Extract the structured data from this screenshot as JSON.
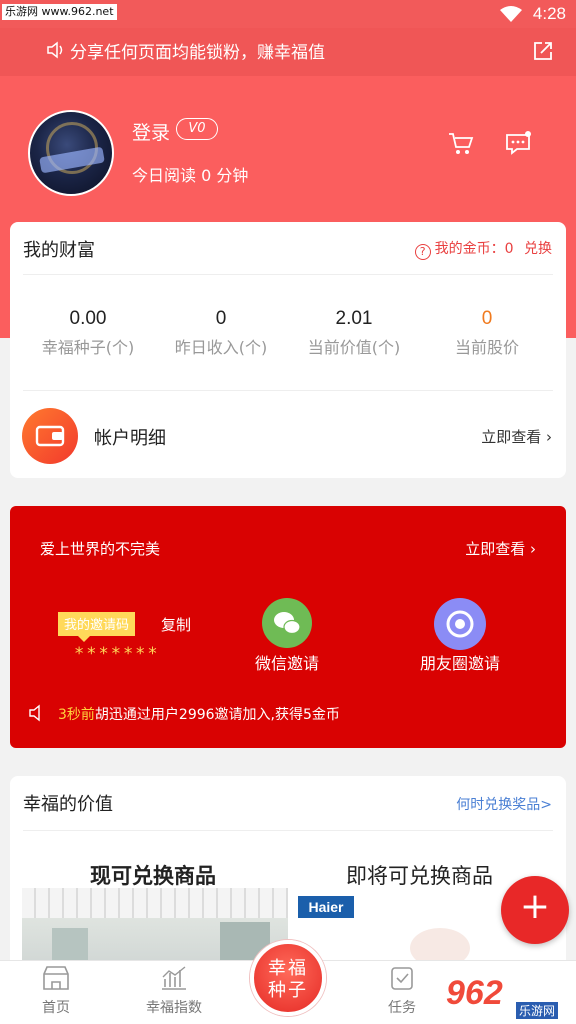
{
  "status_bar": {
    "watermark": "乐游网 www.962.net",
    "time": "4:28"
  },
  "share_bar": {
    "text": "分享任何页面均能锁粉，赚幸福值"
  },
  "profile": {
    "login": "登录",
    "level": "V0",
    "reading": "今日阅读 0 分钟"
  },
  "wealth": {
    "title": "我的财富",
    "coins_label": "我的金币：0",
    "exchange": "兑换",
    "stats": [
      {
        "value": "0.00",
        "label": "幸福种子(个)"
      },
      {
        "value": "0",
        "label": "昨日收入(个)"
      },
      {
        "value": "2.01",
        "label": "当前价值(个)"
      },
      {
        "value": "0",
        "label": "当前股价"
      }
    ],
    "account_label": "帐户明细",
    "view_now": "立即查看"
  },
  "invite": {
    "title": "爱上世界的不完美",
    "view_now": "立即查看",
    "code_tag": "我的邀请码",
    "copy": "复制",
    "code": "*******",
    "wechat": "微信邀请",
    "moments": "朋友圈邀请",
    "notice_time": "3秒前",
    "notice_text": "胡迅通过用户2996邀请加入,获得5金币"
  },
  "value_section": {
    "title": "幸福的价值",
    "link": "何时兑换奖品>",
    "now_title": "现可兑换商品",
    "soon_title": "即将可兑换商品",
    "brand": "Haier"
  },
  "tabs": [
    {
      "label": "首页",
      "icon": "shop-icon"
    },
    {
      "label": "幸福指数",
      "icon": "chart-icon"
    },
    {
      "label": "任务",
      "icon": "clipboard-icon"
    }
  ],
  "center_button": {
    "label": "幸福种子"
  },
  "fab": {
    "symbol": "+"
  },
  "watermark_corner": {
    "big": "962",
    "small": "乐游网"
  },
  "colors": {
    "primary_red": "#fb5e5e",
    "invite_red": "#d90202",
    "accent_orange": "#f07a1e",
    "link_blue": "#4a7fd4",
    "wechat_green": "#6fbb55",
    "moments_purple": "#8b8cf5"
  }
}
